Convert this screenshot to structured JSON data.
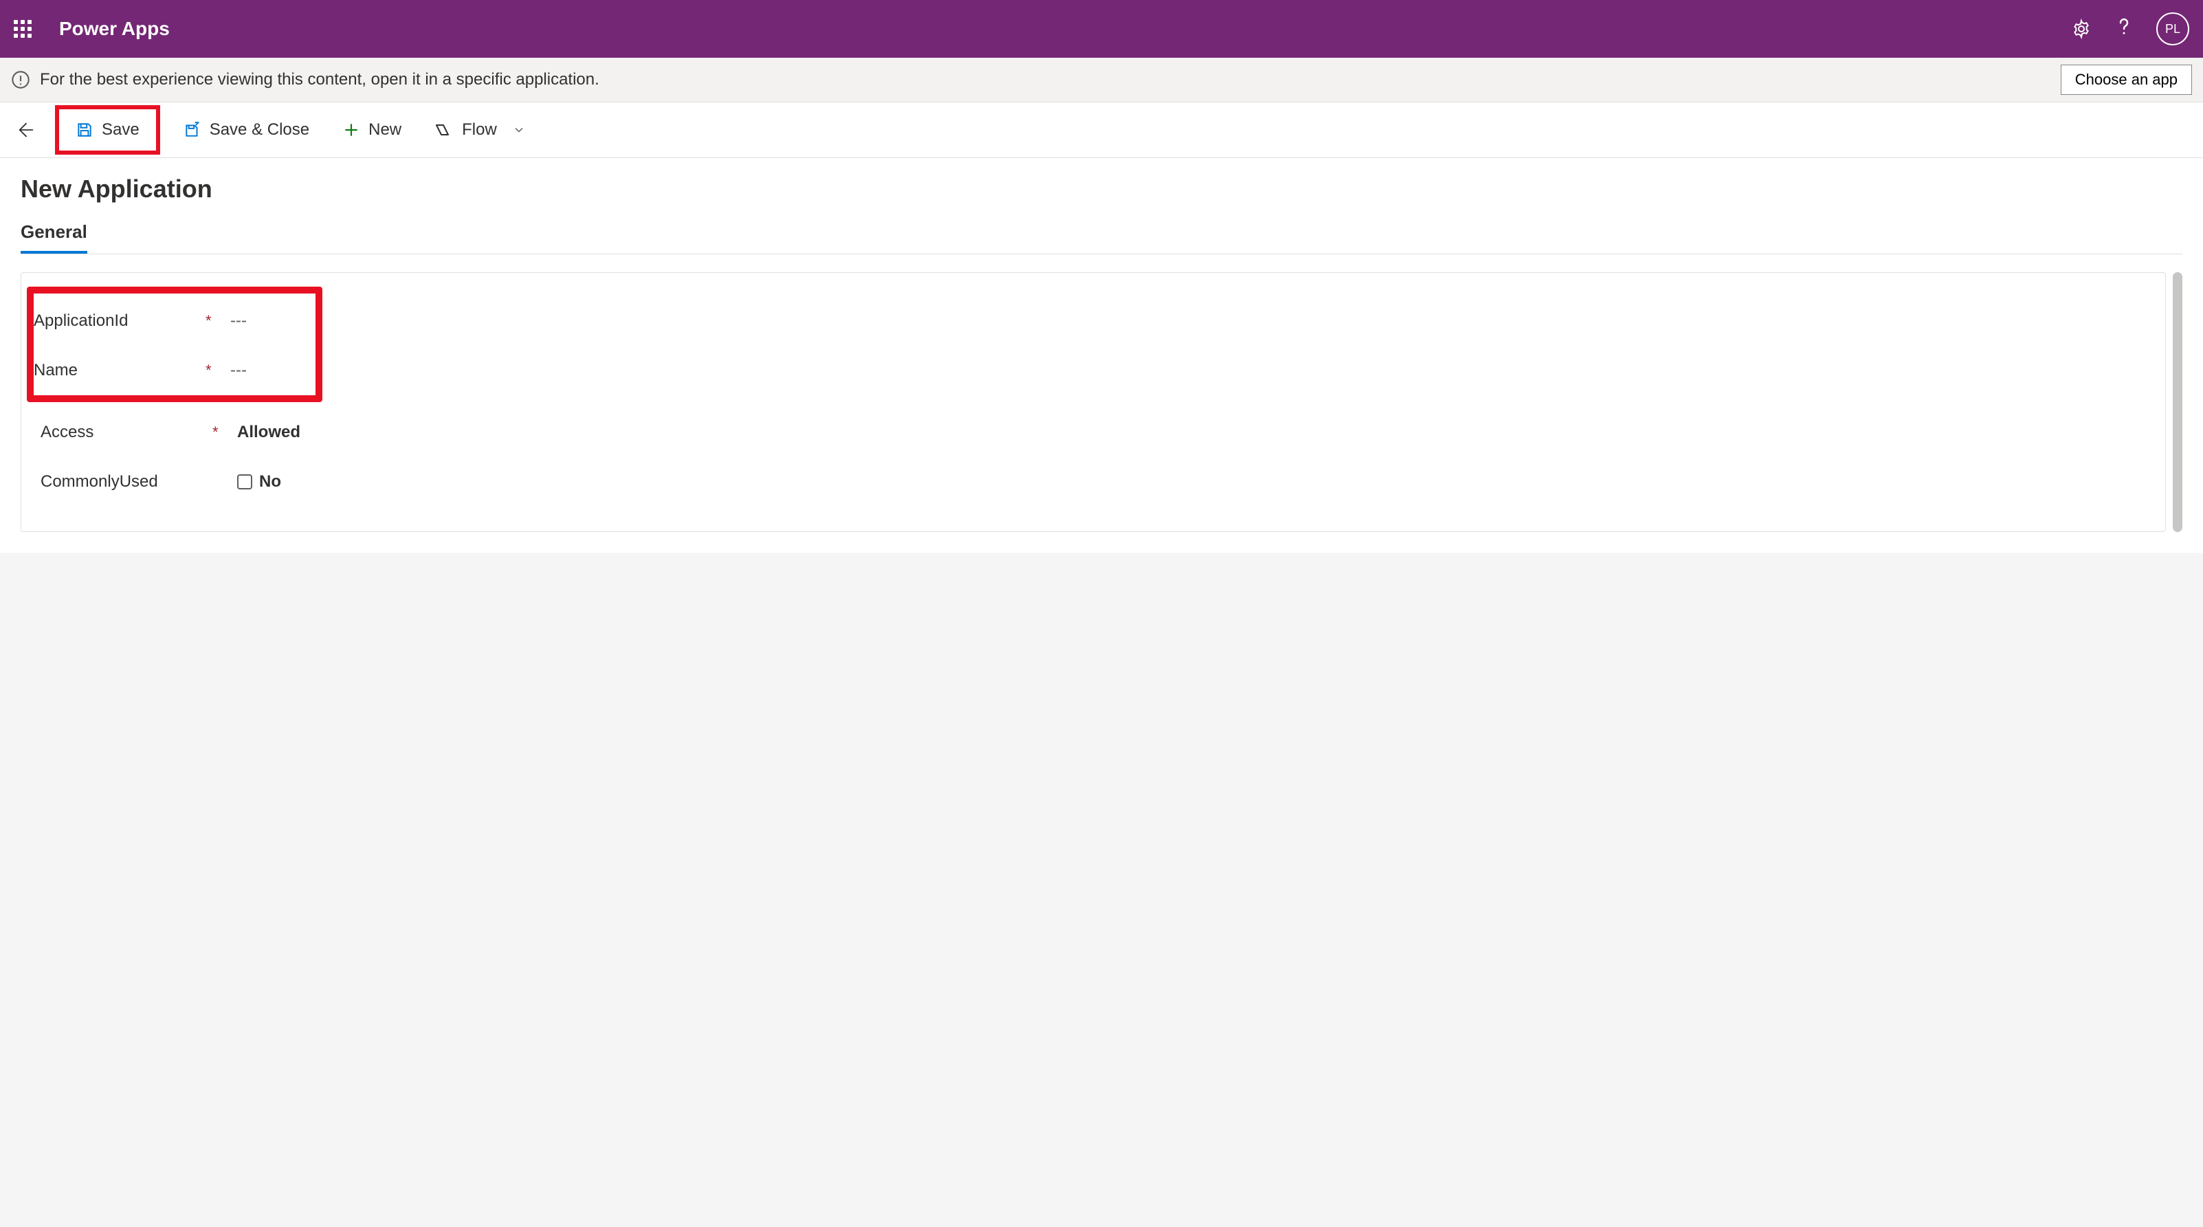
{
  "header": {
    "app_title": "Power Apps",
    "avatar_initials": "PL"
  },
  "info_bar": {
    "message": "For the best experience viewing this content, open it in a specific application.",
    "choose_app_label": "Choose an app"
  },
  "command_bar": {
    "save_label": "Save",
    "save_close_label": "Save & Close",
    "new_label": "New",
    "flow_label": "Flow"
  },
  "page": {
    "title": "New Application",
    "tab_general": "General"
  },
  "form": {
    "fields": [
      {
        "label": "ApplicationId",
        "required": true,
        "value": "---"
      },
      {
        "label": "Name",
        "required": true,
        "value": "---"
      },
      {
        "label": "Access",
        "required": true,
        "value": "Allowed"
      },
      {
        "label": "CommonlyUsed",
        "required": false,
        "value": "No"
      }
    ],
    "required_marker": "*"
  }
}
